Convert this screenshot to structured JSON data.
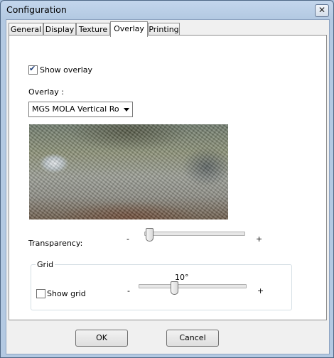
{
  "window": {
    "title": "Configuration",
    "close_glyph": "✕"
  },
  "tabs": [
    {
      "label": "General"
    },
    {
      "label": "Display"
    },
    {
      "label": "Texture"
    },
    {
      "label": "Overlay",
      "active": true
    },
    {
      "label": "Printing"
    }
  ],
  "overlay_tab": {
    "show_overlay": {
      "label": "Show overlay",
      "checked": true
    },
    "overlay_label": "Overlay :",
    "overlay_select": {
      "value": "MGS MOLA Vertical Roughness"
    },
    "transparency": {
      "label": "Transparency:",
      "minus": "-",
      "plus": "+",
      "level": 0.0
    },
    "grid": {
      "title": "Grid",
      "show_grid": {
        "label": "Show grid",
        "checked": false
      },
      "spacing_value": "10°",
      "minus": "-",
      "plus": "+"
    }
  },
  "buttons": {
    "ok": "OK",
    "cancel": "Cancel"
  }
}
